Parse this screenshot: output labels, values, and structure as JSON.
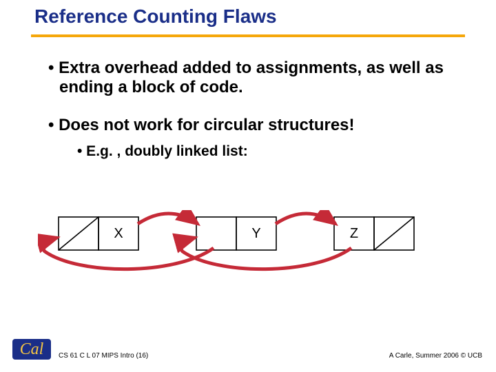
{
  "title": "Reference Counting Flaws",
  "bullets": {
    "b1": "• Extra overhead added to assignments, as well as ending a block of code.",
    "b2": "• Does not work for circular structures!",
    "b2sub": "• E.g. , doubly linked list:"
  },
  "nodes": {
    "x": "X",
    "y": "Y",
    "z": "Z"
  },
  "footer": {
    "left": "CS 61 C L 07 MIPS Intro (16)",
    "right": "A Carle, Summer 2006 © UCB"
  },
  "colors": {
    "title": "#1a2e88",
    "underline": "#f5a70b",
    "arrow": "#c52a37",
    "logo_bg": "#1a2e88",
    "logo_script": "#f5c542"
  }
}
